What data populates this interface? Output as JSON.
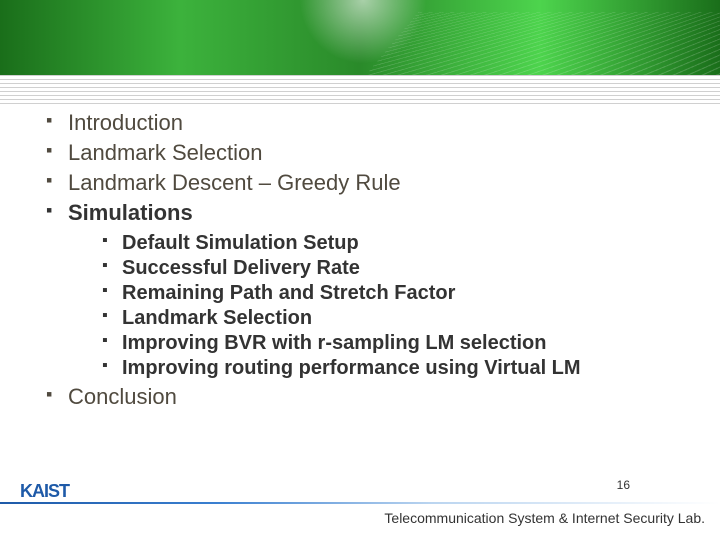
{
  "outline": {
    "items": [
      {
        "label": "Introduction",
        "current": false
      },
      {
        "label": "Landmark Selection",
        "current": false
      },
      {
        "label": "Landmark Descent – Greedy Rule",
        "current": false
      },
      {
        "label": "Simulations",
        "current": true,
        "children": [
          {
            "label": "Default Simulation Setup"
          },
          {
            "label": "Successful Delivery Rate"
          },
          {
            "label": "Remaining Path and Stretch Factor"
          },
          {
            "label": "Landmark Selection"
          },
          {
            "label": "Improving BVR with r-sampling LM selection"
          },
          {
            "label": "Improving routing performance using Virtual LM"
          }
        ]
      },
      {
        "label": "Conclusion",
        "current": false
      }
    ]
  },
  "footer": {
    "logo": "KAIST",
    "page_number": "16",
    "lab": "Telecommunication System & Internet Security Lab."
  }
}
